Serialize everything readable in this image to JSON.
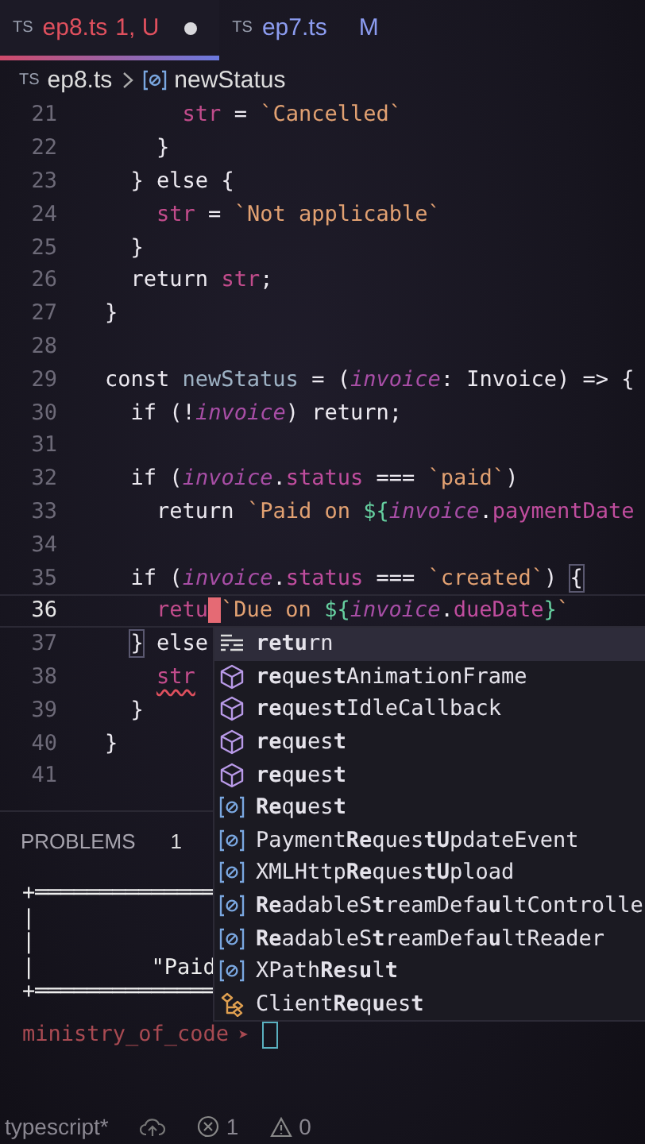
{
  "tabs": [
    {
      "icon_text": "TS",
      "label": "ep8.ts",
      "badge": "1, U",
      "kind": "error",
      "dirty": true,
      "selected": true
    },
    {
      "icon_text": "TS",
      "label": "ep7.ts",
      "badge": "M",
      "kind": "modified",
      "dirty": false,
      "selected": false
    }
  ],
  "breadcrumb": {
    "icon_text": "TS",
    "file": "ep8.ts",
    "symbol": "newStatus"
  },
  "code_lines": [
    {
      "number": "21",
      "current": false,
      "tokens": [
        {
          "t": "      str",
          "kind": "var"
        },
        {
          "t": " = "
        },
        {
          "t": "`Cancelled`",
          "kind": "str"
        }
      ]
    },
    {
      "number": "22",
      "current": false,
      "tokens": [
        {
          "t": "    }"
        }
      ]
    },
    {
      "number": "23",
      "current": false,
      "tokens": [
        {
          "t": "  } "
        },
        {
          "t": "else",
          "kind": "kw"
        },
        {
          "t": " {"
        }
      ]
    },
    {
      "number": "24",
      "current": false,
      "tokens": [
        {
          "t": "    str",
          "kind": "var"
        },
        {
          "t": " = "
        },
        {
          "t": "`Not applicable`",
          "kind": "str"
        }
      ]
    },
    {
      "number": "25",
      "current": false,
      "tokens": [
        {
          "t": "  }"
        }
      ]
    },
    {
      "number": "26",
      "current": false,
      "tokens": [
        {
          "t": "  return",
          "kind": "kw"
        },
        {
          "t": " str",
          "kind": "var"
        },
        {
          "t": ";"
        }
      ]
    },
    {
      "number": "27",
      "current": false,
      "tokens": [
        {
          "t": "}"
        }
      ]
    },
    {
      "number": "28",
      "current": false
    },
    {
      "number": "29",
      "current": false,
      "tokens": [
        {
          "t": "const",
          "kind": "kw"
        },
        {
          "t": " newStatus",
          "kind": "fn"
        },
        {
          "t": " = ("
        },
        {
          "t": "invoice",
          "kind": "param"
        },
        {
          "t": ": "
        },
        {
          "t": "Invoice",
          "kind": "type"
        },
        {
          "t": ") => {"
        }
      ]
    },
    {
      "number": "30",
      "current": false,
      "tokens": [
        {
          "t": "  if",
          "kind": "kw"
        },
        {
          "t": " (!"
        },
        {
          "t": "invoice",
          "kind": "param"
        },
        {
          "t": ") "
        },
        {
          "t": "return",
          "kind": "kw"
        },
        {
          "t": ";"
        }
      ]
    },
    {
      "number": "31",
      "current": false
    },
    {
      "number": "32",
      "current": false,
      "tokens": [
        {
          "t": "  if",
          "kind": "kw"
        },
        {
          "t": " ("
        },
        {
          "t": "invoice",
          "kind": "param"
        },
        {
          "t": "."
        },
        {
          "t": "status",
          "kind": "prop"
        },
        {
          "t": " === "
        },
        {
          "t": "`paid`",
          "kind": "str"
        },
        {
          "t": ")"
        }
      ]
    },
    {
      "number": "33",
      "current": false,
      "tokens": [
        {
          "t": "    return",
          "kind": "kw"
        },
        {
          "t": " `Paid on ",
          "kind": "str"
        },
        {
          "t": "${",
          "kind": "tpl"
        },
        {
          "t": "invoice",
          "kind": "param"
        },
        {
          "t": "."
        },
        {
          "t": "paymentDate",
          "kind": "prop"
        }
      ]
    },
    {
      "number": "34",
      "current": false
    },
    {
      "number": "35",
      "current": false,
      "tokens": [
        {
          "t": "  if",
          "kind": "kw"
        },
        {
          "t": " ("
        },
        {
          "t": "invoice",
          "kind": "param"
        },
        {
          "t": "."
        },
        {
          "t": "status",
          "kind": "prop"
        },
        {
          "t": " === "
        },
        {
          "t": "`created`",
          "kind": "str"
        },
        {
          "t": ") "
        },
        {
          "t": "{",
          "match": true
        }
      ]
    },
    {
      "number": "36",
      "current": true,
      "tokens": [
        {
          "t": "    retu",
          "kind": "var",
          "cursor": true
        },
        {
          "t": "`Due on ",
          "kind": "str"
        },
        {
          "t": "${",
          "kind": "tpl"
        },
        {
          "t": "invoice",
          "kind": "param"
        },
        {
          "t": "."
        },
        {
          "t": "dueDate",
          "kind": "prop"
        },
        {
          "t": "}",
          "kind": "tpl"
        },
        {
          "t": "`",
          "kind": "str"
        }
      ]
    },
    {
      "number": "37",
      "current": false,
      "tokens": [
        {
          "t": "  }",
          "match": true
        },
        {
          "t": " else",
          "kind": "kw"
        }
      ]
    },
    {
      "number": "38",
      "current": false,
      "tokens": [
        {
          "t": "    str",
          "kind": "var",
          "squiggle": true
        }
      ]
    },
    {
      "number": "39",
      "current": false,
      "tokens": [
        {
          "t": "  }"
        }
      ]
    },
    {
      "number": "40",
      "current": false,
      "tokens": [
        {
          "t": "}"
        }
      ]
    },
    {
      "number": "41",
      "current": false
    }
  ],
  "suggestions": [
    {
      "kind": "keyword",
      "label": "**retu**rn",
      "selected": true
    },
    {
      "kind": "method",
      "label": "**re**q**u**es**t**AnimationFrame",
      "selected": false
    },
    {
      "kind": "method",
      "label": "**re**q**u**es**t**IdleCallback",
      "selected": false
    },
    {
      "kind": "method",
      "label": "**re**q**u**es**t**",
      "selected": false
    },
    {
      "kind": "method",
      "label": "**re**q**u**es**t**",
      "selected": false
    },
    {
      "kind": "variable",
      "label": "**Re**q**u**es**t**",
      "selected": false
    },
    {
      "kind": "variable",
      "label": "Payment**Re**ques**tU**pdateEvent",
      "selected": false
    },
    {
      "kind": "variable",
      "label": "XMLHttp**Re**ques**tU**pload",
      "selected": false
    },
    {
      "kind": "variable",
      "label": "**Re**adableS**t**reamDefa**u**ltControlle",
      "selected": false
    },
    {
      "kind": "variable",
      "label": "**Re**adableS**t**reamDefa**u**ltReader",
      "selected": false
    },
    {
      "kind": "variable",
      "label": "XPath**Re**s**u**l**t**",
      "selected": false
    },
    {
      "kind": "class",
      "label": "Client**Re**q**u**es**t**",
      "selected": false
    }
  ],
  "panel": {
    "tab": "PROBLEMS",
    "count": "1"
  },
  "terminal_lines": [
    "+══════════════",
    "|",
    "|",
    "|         \"Paid",
    "+══════════════"
  ],
  "prompt": {
    "user": "ministry_of_code",
    "arrow": "➤"
  },
  "status_bar": {
    "language": "typescript*",
    "errors": "1",
    "warnings": "0"
  }
}
